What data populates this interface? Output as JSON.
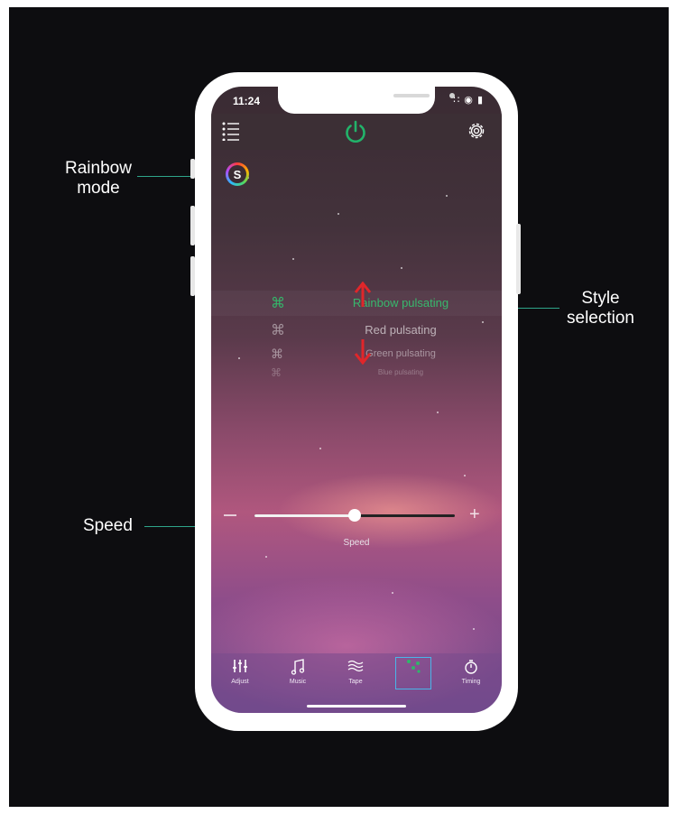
{
  "annotations": {
    "rainbow_mode": "Rainbow\nmode",
    "style_selection": "Style\nselection",
    "speed": "Speed"
  },
  "status_bar": {
    "time": "11:24",
    "icons": "∷ ◉ ▮"
  },
  "top_bar": {
    "menu_icon": "list-menu-icon",
    "power_icon": "power-icon",
    "settings_icon": "gear-icon",
    "power_color": "#22b36a"
  },
  "rainbow_badge": {
    "letter": "S"
  },
  "styles": {
    "items": [
      {
        "label": "Rainbow pulsating",
        "selected": true
      },
      {
        "label": "Red pulsating",
        "selected": false
      },
      {
        "label": "Green pulsating",
        "selected": false
      },
      {
        "label": "Blue pulsating",
        "selected": false
      }
    ]
  },
  "speed": {
    "label": "Speed",
    "value_fraction": 0.5,
    "minus": "−",
    "plus": "+"
  },
  "tabs": [
    {
      "label": "Adjust",
      "icon": "sliders-icon",
      "glyph": "⫾⫾"
    },
    {
      "label": "Music",
      "icon": "music-note-icon",
      "glyph": "♫"
    },
    {
      "label": "Tape",
      "icon": "waves-icon",
      "glyph": "≈"
    },
    {
      "label": "",
      "icon": "mode-icon",
      "glyph": "⁙",
      "active": true
    },
    {
      "label": "Timing",
      "icon": "timer-icon",
      "glyph": "⏱"
    }
  ],
  "colors": {
    "accent_green": "#38b86d",
    "annotation_line": "#2ea58a",
    "arrow_red": "#e0262a",
    "active_tab_border": "#4ab5e8"
  }
}
